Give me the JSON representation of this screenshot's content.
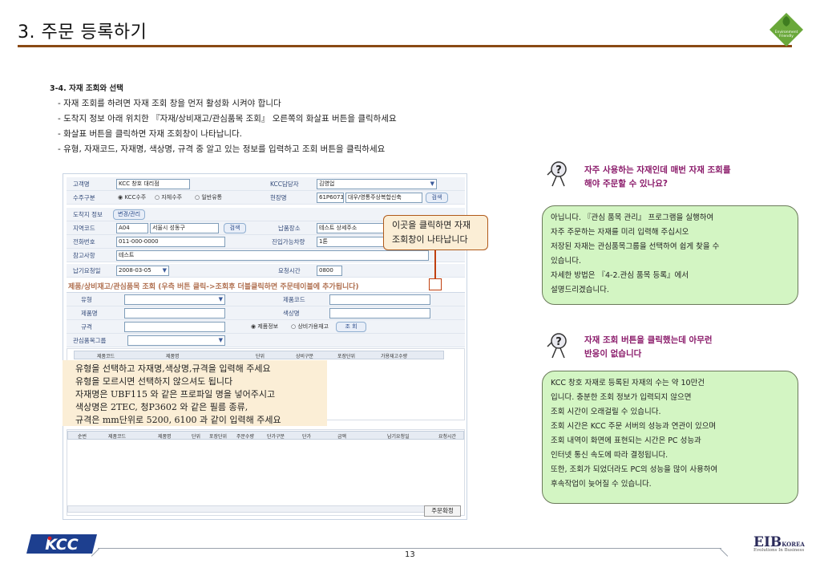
{
  "page": {
    "title": "3. 주문 등록하기",
    "number": "13"
  },
  "logos": {
    "leaf_line1": "Environment",
    "leaf_line2": "Friendly",
    "kcc": "KCC",
    "eib_main": "EIB",
    "eib_sub": "KOREA",
    "eib_tagline": "Evolutions In Business"
  },
  "section": {
    "heading": "3-4. 자재 조회와 선택",
    "bullets": [
      "- 자재 조회를 하려면 자재 조회 창을 먼저 활성화 시켜야 합니다",
      "- 도착지 정보 아래 위치한 『자재/상비재고/관심품목 조회』 오른쪽의 화살표 버튼을 클릭하세요",
      "- 화살표 버튼을 클릭하면 자재 조회창이 나타납니다.",
      "- 유형, 자재코드, 자재명, 색상명, 규격 중 알고 있는 정보를 입력하고 조회 버튼을 클릭하세요"
    ]
  },
  "form": {
    "customer_label": "고객명",
    "customer_value": "KCC 창호 대리점",
    "kcc_rep_label": "KCC담당자",
    "kcc_rep_value": "김영업",
    "order_type_label": "수주구분",
    "order_type_options": [
      "KCC수주",
      "자체수주",
      "일반유통"
    ],
    "site_label": "현장명",
    "site_code": "61P6073",
    "site_name": "대우/영통주상복합신축",
    "search_label": "검색",
    "dest_label": "도착지 정보",
    "change_label": "변경/관리",
    "region_label": "지역코드",
    "region_code": "A04",
    "region_name": "서울시 성동구",
    "delivery_label": "납품장소",
    "delivery_value": "테스트 상세주소",
    "phone_label": "전화번호",
    "phone_value": "011-000-0000",
    "vehicle_label": "진입가능차량",
    "vehicle_value": "1톤",
    "note_label": "참고사항",
    "note_value": "테스트",
    "due_label": "납기요청일",
    "due_value": "2008-03-05",
    "time_label": "요청시간",
    "time_value": "0800",
    "lookup_header": "제품/상비재고/관심품목 조회 (우측 버튼 클릭->조회후 더블클릭하면 주문테이블에 추가됩니다)",
    "type_label": "유형",
    "product_code_label": "제품코드",
    "product_name_label": "제품명",
    "color_label": "색상명",
    "spec_label": "규격",
    "lookup_option_a": "제품정보",
    "lookup_option_b": "상비가용재고",
    "lookup_button": "조 회",
    "interest_label": "관심품목그룹",
    "grid1_cols": [
      "제품코드",
      "제품명",
      "단위",
      "상비구분",
      "포장단위",
      "가용재고수량"
    ],
    "grid2_cols": [
      "순번",
      "제품코드",
      "제품명",
      "단위",
      "포장단위",
      "주문수량",
      "단가구분",
      "단가",
      "금액",
      "납기요청일",
      "요청시간"
    ],
    "confirm_button": "주문확정"
  },
  "callouts": {
    "click_here": [
      "이곳을 클릭하면 자재",
      "조회창이 나타납니다"
    ],
    "howto": [
      "유형을 선택하고 자재명,색상명,규격을 입력해 주세요",
      "유형을 모르시면 선택하지 않으셔도 됩니다",
      "자재명은 UBF115 와 같은 프로파일 명을 넣어주시고",
      "색상명은 2TEC, 청P3602 와 같은 필름 종류,",
      "규격은 mm단위로 5200, 6100 과 같이 입력해 주세요"
    ]
  },
  "faq": [
    {
      "question": [
        "자주 사용하는 자재인데 매번 자재 조회를",
        "해야 주문할 수 있나요?"
      ],
      "answer": [
        "아닙니다. 『관심 품목 관리』 프로그램을 실행하여",
        "자주 주문하는 자재를 미리 입력해 주십시오",
        "저장된 자재는 관심품목그룹을 선택하여 쉽게 찾을 수",
        "있습니다.",
        "자세한 방법은 『4-2.관심 품목 등록』에서",
        "설명드리겠습니다."
      ]
    },
    {
      "question": [
        "자재 조회 버튼을 클릭했는데 아무런",
        "반응이 없습니다"
      ],
      "answer": [
        "KCC 창호 자재로 등록된 자재의 수는 약 10만건",
        "입니다. 충분한 조회 정보가 입력되지 않으면",
        "조회 시간이 오래걸릴 수 있습니다.",
        "조회 시간은 KCC 주문 서버의 성능과 연관이 있으며",
        "조회 내역이 화면에 표현되는 시간은 PC 성능과",
        "인터넷 통신 속도에 따라 결정됩니다.",
        "또한, 조회가 되었더라도 PC의 성능을 많이 사용하여",
        "후속작업이 늦어질 수 있습니다."
      ]
    }
  ]
}
